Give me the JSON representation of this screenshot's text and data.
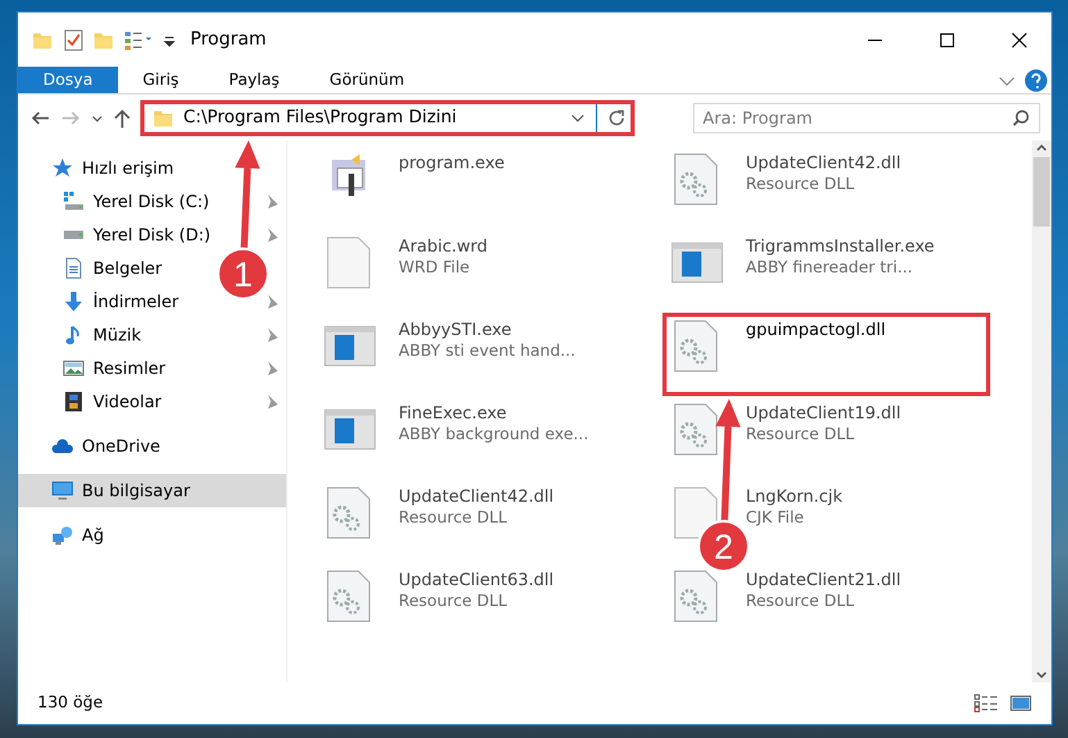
{
  "window": {
    "title": "Program"
  },
  "ribbon": {
    "tabs": [
      {
        "label": "Dosya",
        "kind": "file",
        "selected": false
      },
      {
        "label": "Giriş",
        "kind": "tab",
        "selected": false
      },
      {
        "label": "Paylaş",
        "kind": "tab",
        "selected": false
      },
      {
        "label": "Görünüm",
        "kind": "tab",
        "selected": false
      }
    ]
  },
  "address_bar": {
    "path": "C:\\Program Files\\Program Dizini",
    "highlighted": true
  },
  "search": {
    "placeholder": "Ara: Program"
  },
  "sidebar": {
    "items": [
      {
        "label": "Hızlı erişim",
        "kind": "quick-access",
        "selected": false,
        "children": [
          {
            "label": "Yerel Disk (C:)",
            "kind": "system-drive",
            "pinned": true,
            "selected": false
          },
          {
            "label": "Yerel Disk (D:)",
            "kind": "drive",
            "pinned": true,
            "selected": false
          },
          {
            "label": "Belgeler",
            "kind": "documents",
            "selected": false
          },
          {
            "label": "İndirmeler",
            "kind": "downloads",
            "pinned": true,
            "selected": false
          },
          {
            "label": "Müzik",
            "kind": "music",
            "pinned": true,
            "selected": false
          },
          {
            "label": "Resimler",
            "kind": "pictures",
            "pinned": true,
            "selected": false
          },
          {
            "label": "Videolar",
            "kind": "videos",
            "pinned": true,
            "selected": false
          }
        ]
      },
      {
        "label": "OneDrive",
        "kind": "cloud",
        "selected": false
      },
      {
        "label": "Bu bilgisayar",
        "kind": "computer",
        "selected": true
      },
      {
        "label": "Ağ",
        "kind": "network",
        "selected": false
      }
    ]
  },
  "files": [
    {
      "name": "program.exe",
      "kind": "setup",
      "highlighted": false
    },
    {
      "name": "UpdateClient42.dll",
      "description": "Resource DLL",
      "kind": "dll",
      "highlighted": false
    },
    {
      "name": "Arabic.wrd",
      "description": "WRD File",
      "kind": "blank",
      "highlighted": false
    },
    {
      "name": "TrigrammsInstaller.exe",
      "description": "ABBY finereader tri...",
      "kind": "app",
      "highlighted": false
    },
    {
      "name": "AbbyySTI.exe",
      "description": "ABBY sti event hand...",
      "kind": "app",
      "highlighted": false
    },
    {
      "name": "gpuimpactogl.dll",
      "kind": "dll",
      "highlighted": true
    },
    {
      "name": "FineExec.exe",
      "description": "ABBY background exe...",
      "kind": "app",
      "highlighted": false
    },
    {
      "name": "UpdateClient19.dll",
      "description": "Resource DLL",
      "kind": "dll",
      "highlighted": false
    },
    {
      "name": "UpdateClient42.dll",
      "description": "Resource DLL",
      "kind": "dll",
      "highlighted": false
    },
    {
      "name": "LngKorn.cjk",
      "description": "CJK File",
      "kind": "blank",
      "highlighted": false
    },
    {
      "name": "UpdateClient63.dll",
      "description": "Resource DLL",
      "kind": "dll",
      "highlighted": false
    },
    {
      "name": "UpdateClient21.dll",
      "description": "Resource DLL",
      "kind": "dll",
      "highlighted": false
    }
  ],
  "status_bar": {
    "item_count": "130 öğe"
  },
  "annotations": [
    {
      "label": "1"
    },
    {
      "label": "2"
    }
  ]
}
